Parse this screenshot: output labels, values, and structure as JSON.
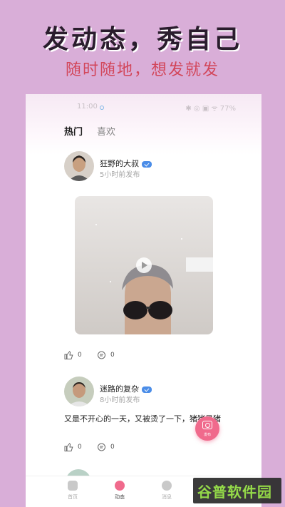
{
  "promo": {
    "headline": "发动态，秀自己",
    "subline": "随时随地，想发就发"
  },
  "status_bar": {
    "time": "11:00",
    "right": "✱ ◎ ▣ ᯤ 77%"
  },
  "tabs": [
    {
      "label": "热门",
      "active": true
    },
    {
      "label": "喜欢",
      "active": false
    }
  ],
  "posts": [
    {
      "username": "狂野的大叔",
      "time_ago": "5小时前发布",
      "like_count": "0",
      "comment_count": "0"
    },
    {
      "username": "迷路的复杂",
      "time_ago": "8小时前发布",
      "text": "又是不开心的一天，又被烫了一下，猪猪是猪",
      "like_count": "0",
      "comment_count": "0"
    }
  ],
  "fab": {
    "label": "发布"
  },
  "bottom_nav": [
    {
      "label": "首页",
      "icon": "home-icon"
    },
    {
      "label": "动态",
      "icon": "compass-icon",
      "active": true
    },
    {
      "label": "消息",
      "icon": "message-icon"
    }
  ],
  "watermark": {
    "text": "谷普软件园"
  }
}
